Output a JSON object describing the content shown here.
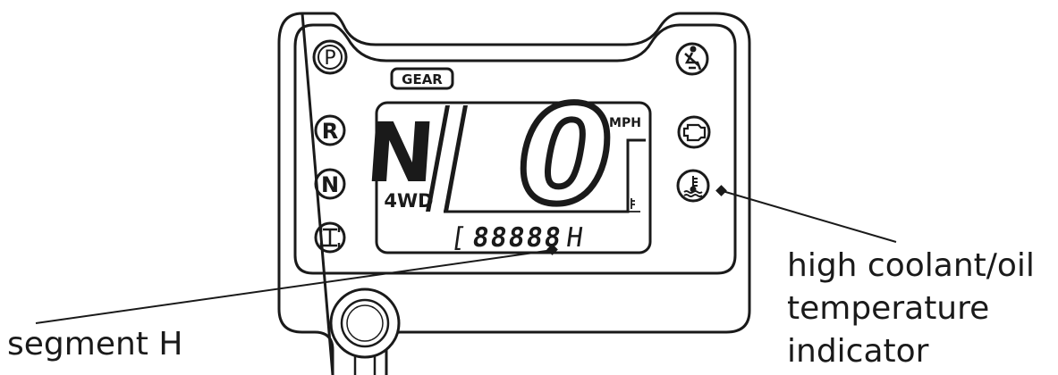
{
  "gear_badge": "GEAR",
  "left_indicators": [
    {
      "label": "P",
      "icon": "park-brake-icon"
    },
    {
      "label": "R",
      "icon": "reverse-icon"
    },
    {
      "label": "N",
      "icon": "neutral-icon"
    },
    {
      "label": "",
      "icon": "awd-drivetrain-icon"
    }
  ],
  "right_indicators": [
    {
      "icon": "seatbelt-icon"
    },
    {
      "icon": "check-engine-icon"
    },
    {
      "icon": "coolant-temperature-icon"
    }
  ],
  "lcd": {
    "gear_letter": "N",
    "drive_mode": "4WD",
    "speed_value": "0",
    "speed_unit": "MPH",
    "odometer_prefix": "[",
    "odometer_digits": "88888",
    "odometer_suffix": "H"
  },
  "callouts": {
    "segment_h": "segment H",
    "coolant_line1": "high coolant/oil",
    "coolant_line2": "temperature",
    "coolant_line3": "indicator"
  },
  "colors": {
    "ink": "#1a1a1a",
    "lcd_fill": "#ffffff",
    "background": "#ffffff"
  }
}
